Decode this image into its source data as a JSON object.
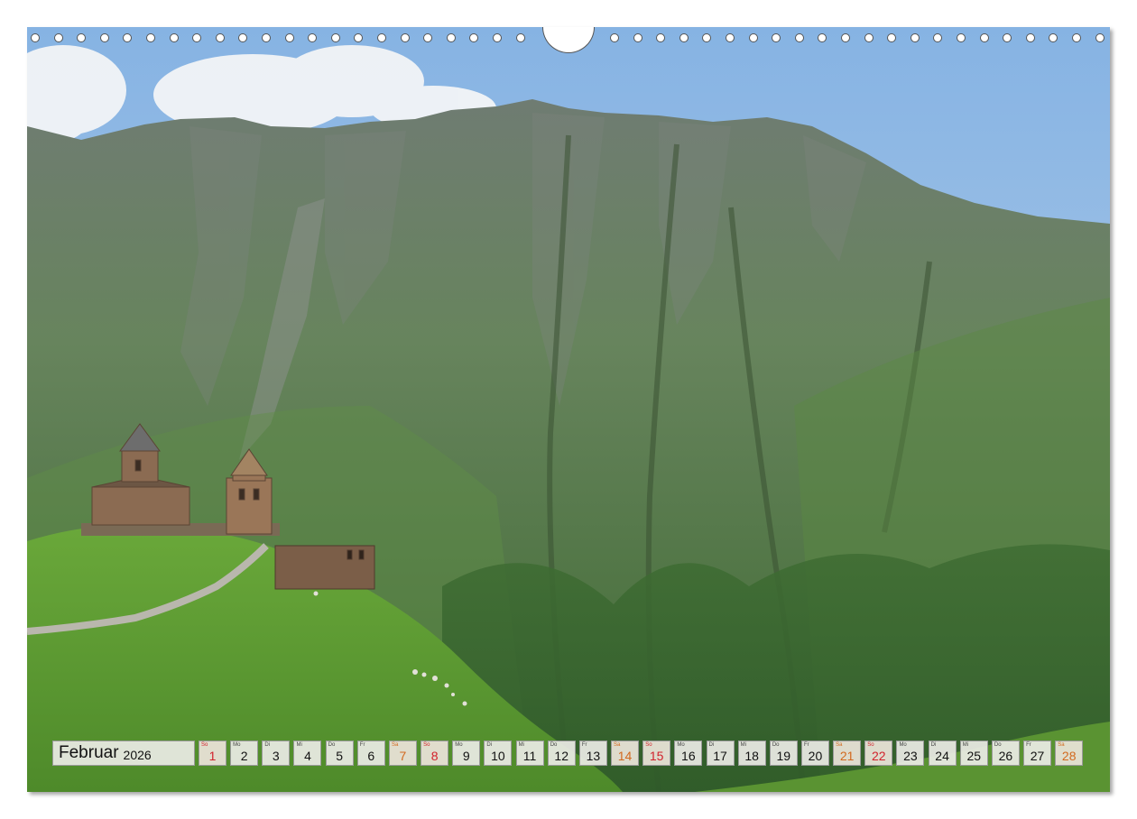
{
  "calendar": {
    "month": "Februar",
    "year": "2026",
    "days": [
      {
        "wd": "So",
        "num": "1",
        "kind": "sun"
      },
      {
        "wd": "Mo",
        "num": "2",
        "kind": ""
      },
      {
        "wd": "Di",
        "num": "3",
        "kind": ""
      },
      {
        "wd": "Mi",
        "num": "4",
        "kind": ""
      },
      {
        "wd": "Do",
        "num": "5",
        "kind": ""
      },
      {
        "wd": "Fr",
        "num": "6",
        "kind": ""
      },
      {
        "wd": "Sa",
        "num": "7",
        "kind": "sat"
      },
      {
        "wd": "So",
        "num": "8",
        "kind": "sun"
      },
      {
        "wd": "Mo",
        "num": "9",
        "kind": ""
      },
      {
        "wd": "Di",
        "num": "10",
        "kind": ""
      },
      {
        "wd": "Mi",
        "num": "11",
        "kind": ""
      },
      {
        "wd": "Do",
        "num": "12",
        "kind": ""
      },
      {
        "wd": "Fr",
        "num": "13",
        "kind": ""
      },
      {
        "wd": "Sa",
        "num": "14",
        "kind": "sat"
      },
      {
        "wd": "So",
        "num": "15",
        "kind": "sun"
      },
      {
        "wd": "Mo",
        "num": "16",
        "kind": ""
      },
      {
        "wd": "Di",
        "num": "17",
        "kind": ""
      },
      {
        "wd": "Mi",
        "num": "18",
        "kind": ""
      },
      {
        "wd": "Do",
        "num": "19",
        "kind": ""
      },
      {
        "wd": "Fr",
        "num": "20",
        "kind": ""
      },
      {
        "wd": "Sa",
        "num": "21",
        "kind": "sat"
      },
      {
        "wd": "So",
        "num": "22",
        "kind": "sun"
      },
      {
        "wd": "Mo",
        "num": "23",
        "kind": ""
      },
      {
        "wd": "Di",
        "num": "24",
        "kind": ""
      },
      {
        "wd": "Mi",
        "num": "25",
        "kind": ""
      },
      {
        "wd": "Do",
        "num": "26",
        "kind": ""
      },
      {
        "wd": "Fr",
        "num": "27",
        "kind": ""
      },
      {
        "wd": "Sa",
        "num": "28",
        "kind": "sat"
      }
    ]
  },
  "colors": {
    "sky": "#9cc0e6",
    "mountain": "#5e7a58",
    "grass": "#5e9a34",
    "saturday": "#d2691e",
    "sunday": "#d2212b"
  },
  "icons": {
    "hanger": "calendar-hanger-icon",
    "hole": "binding-hole-icon"
  }
}
